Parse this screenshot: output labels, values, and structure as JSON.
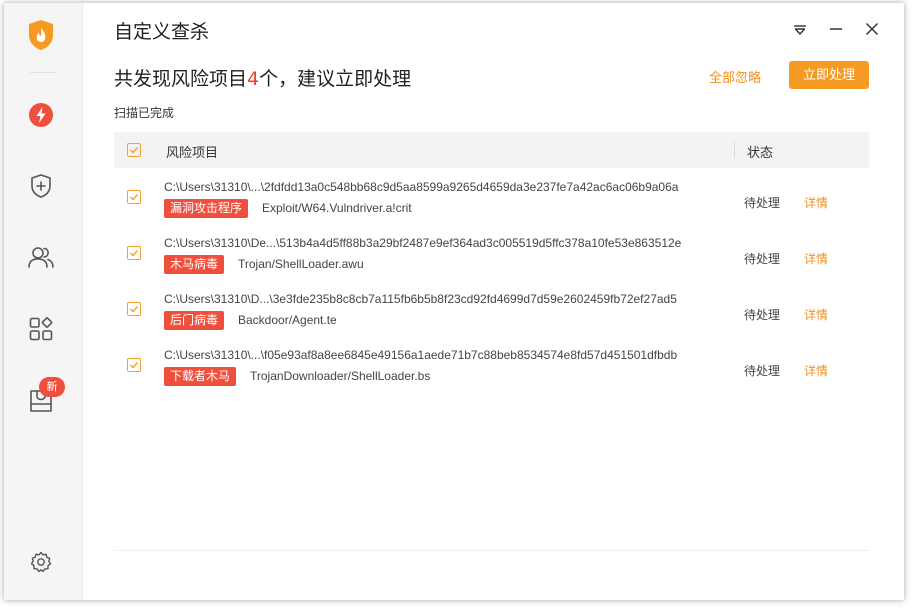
{
  "window": {
    "title": "自定义查杀"
  },
  "sidebar": {
    "logo_icon": "flame-shield-logo",
    "items": [
      {
        "name": "lightning-icon"
      },
      {
        "name": "shield-plus-icon"
      },
      {
        "name": "users-icon"
      },
      {
        "name": "apps-icon"
      },
      {
        "name": "toolbox-icon",
        "badge": "新"
      }
    ],
    "settings_icon": "gear-icon"
  },
  "header": {
    "headline_prefix": "共发现风险项目",
    "count": "4",
    "headline_suffix": "个，建议立即处理",
    "ignore_all": "全部忽略",
    "handle_now": "立即处理",
    "scan_status": "扫描已完成"
  },
  "table": {
    "columns": [
      "风险项目",
      "状态"
    ],
    "rows": [
      {
        "path": "C:\\Users\\31310\\...\\2fdfdd13a0c548bb68c9d5aa8599a9265d4659da3e237fe7a42ac6ac06b9a06a",
        "tag": "漏洞攻击程序",
        "threat": "Exploit/W64.Vulndriver.a!crit",
        "status": "待处理",
        "detail": "详情"
      },
      {
        "path": "C:\\Users\\31310\\De...\\513b4a4d5ff88b3a29bf2487e9ef364ad3c005519d5ffc378a10fe53e863512e",
        "tag": "木马病毒",
        "threat": "Trojan/ShellLoader.awu",
        "status": "待处理",
        "detail": "详情"
      },
      {
        "path": "C:\\Users\\31310\\D...\\3e3fde235b8c8cb7a115fb6b5b8f23cd92fd4699d7d59e2602459fb72ef27ad5",
        "tag": "后门病毒",
        "threat": "Backdoor/Agent.te",
        "status": "待处理",
        "detail": "详情"
      },
      {
        "path": "C:\\Users\\31310\\...\\f05e93af8a8ee6845e49156a1aede71b7c88beb8534574e8fd57d451501dfbdb",
        "tag": "下载者木马",
        "threat": "TrojanDownloader/ShellLoader.bs",
        "status": "待处理",
        "detail": "详情"
      }
    ]
  },
  "colors": {
    "accent": "#f59a23",
    "danger": "#ef4f3d",
    "link": "#ee9120"
  }
}
